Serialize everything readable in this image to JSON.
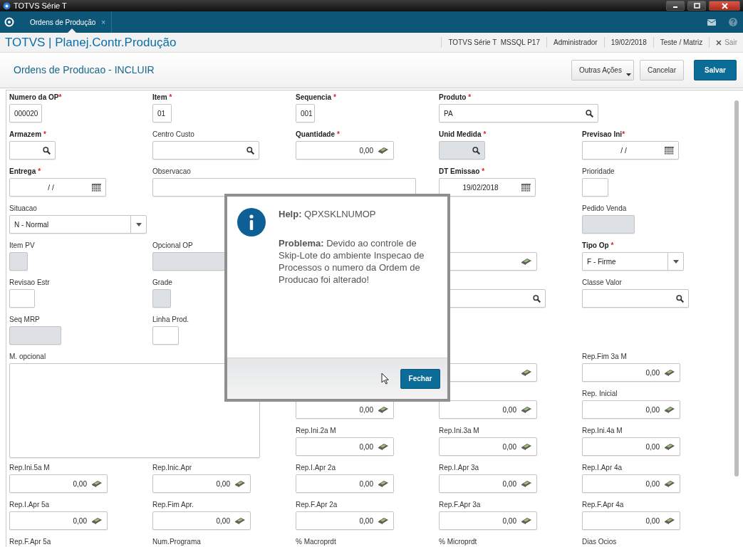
{
  "window": {
    "title": "TOTVS Série T"
  },
  "tabs": [
    {
      "label": "Ordens de Produção",
      "close": "×",
      "selected": true
    }
  ],
  "app_header": {
    "title": "TOTVS | Planej.Contr.Produção",
    "info": [
      "TOTVS Série T  MSSQL P17",
      "Administrador",
      "19/02/2018",
      "Teste / Matriz"
    ],
    "logout": "Sair"
  },
  "page": {
    "title": "Ordens de Producao - INCLUIR",
    "buttons": [
      {
        "label": "Outras Ações",
        "kind": "menu"
      },
      {
        "label": "Cancelar",
        "kind": "default"
      },
      {
        "label": "Salvar",
        "kind": "primary"
      }
    ]
  },
  "form": {
    "rows": [
      [
        {
          "kind": "text",
          "label": "Numero da OP",
          "mark": "*",
          "value": "000020",
          "disabled": false
        },
        {
          "kind": "text",
          "label": "Item",
          "mark": "*",
          "value": "01",
          "disabled": false
        },
        {
          "kind": "text",
          "label": "Sequencia",
          "mark": "*",
          "value": "001",
          "disabled": false
        },
        {
          "kind": "search",
          "label": "Produto",
          "mark": "*",
          "value": "PA",
          "disabled": false
        },
        {
          "kind": "none"
        }
      ],
      [
        {
          "kind": "search",
          "label": "Armazem",
          "mark": "*",
          "disabled": false
        },
        {
          "kind": "search",
          "label": "Centro Custo",
          "disabled": false
        },
        {
          "kind": "calc",
          "label": "Quantidade",
          "mark": "*",
          "value": "0,00",
          "disabled": false
        },
        {
          "kind": "search",
          "label": "Unid Medida",
          "mark": "*",
          "disabled": true
        },
        {
          "kind": "date",
          "label": "Previsao Ini",
          "mark": "*",
          "value": "/ /",
          "disabled": false
        }
      ],
      [
        {
          "kind": "date",
          "label": "Entrega",
          "mark": "*",
          "value": "/ /",
          "disabled": false
        },
        {
          "kind": "text",
          "label": "Observacao",
          "disabled": false
        },
        {
          "kind": "none"
        },
        {
          "kind": "date",
          "label": "DT Emissao",
          "mark": "*",
          "value": "19/02/2018",
          "disabled": false
        },
        {
          "kind": "text",
          "label": "Prioridade",
          "disabled": false
        }
      ],
      [
        {
          "kind": "select",
          "label": "Situacao",
          "value": "N - Normal",
          "disabled": false
        },
        {
          "kind": "none"
        },
        {
          "kind": "none"
        },
        {
          "kind": "none"
        },
        {
          "kind": "text",
          "label": "Pedido Venda",
          "disabled": true
        }
      ],
      [
        {
          "kind": "text",
          "label": "Item PV",
          "disabled": true
        },
        {
          "kind": "text",
          "label": "Opcional OP",
          "disabled": true
        },
        {
          "kind": "none"
        },
        {
          "kind": "calc",
          "disabled": false
        },
        {
          "kind": "select",
          "label": "Tipo Op",
          "mark": "*",
          "value": "F - Firme",
          "disabled": false
        }
      ],
      [
        {
          "kind": "text",
          "label": "Revisao Estr",
          "disabled": false
        },
        {
          "kind": "text",
          "label": "Grade",
          "disabled": true
        },
        {
          "kind": "none"
        },
        {
          "kind": "search",
          "disabled": false
        },
        {
          "kind": "search",
          "label": "Classe Valor",
          "disabled": false
        }
      ],
      [
        {
          "kind": "text",
          "label": "Seq MRP",
          "disabled": true
        },
        {
          "kind": "text",
          "label": "Linha Prod.",
          "disabled": false
        },
        {
          "kind": "none"
        },
        {
          "kind": "none"
        },
        {
          "kind": "none"
        }
      ],
      [
        {
          "kind": "memo",
          "label": "M. opcional",
          "disabled": false
        },
        {
          "kind": "none"
        },
        {
          "kind": "none"
        },
        {
          "kind": "calc",
          "disabled": false
        },
        {
          "kind": "calc",
          "label": "Rep.Fim 3a M",
          "value": "0,00",
          "disabled": false
        }
      ],
      [
        {
          "kind": "none"
        },
        {
          "kind": "none"
        },
        {
          "kind": "calc",
          "value": "0,00",
          "disabled": false
        },
        {
          "kind": "calc",
          "value": "0,00",
          "disabled": false
        },
        {
          "kind": "calc",
          "label": "Rep. Inicial",
          "value": "0,00",
          "disabled": false
        }
      ],
      [
        {
          "kind": "none"
        },
        {
          "kind": "none"
        },
        {
          "kind": "calc",
          "label": "Rep.Ini.2a M",
          "value": "0,00",
          "disabled": false
        },
        {
          "kind": "calc",
          "label": "Rep.Ini.3a M",
          "value": "0,00",
          "disabled": false
        },
        {
          "kind": "calc",
          "label": "Rep.Ini.4a M",
          "value": "0,00",
          "disabled": false
        }
      ],
      [
        {
          "kind": "calc",
          "label": "Rep.Ini.5a M",
          "value": "0,00",
          "disabled": false
        },
        {
          "kind": "calc",
          "label": "Rep.Inic.Apr",
          "value": "0,00",
          "disabled": false
        },
        {
          "kind": "calc",
          "label": "Rep.I.Apr 2a",
          "value": "0,00",
          "disabled": false
        },
        {
          "kind": "calc",
          "label": "Rep.I.Apr 3a",
          "value": "0,00",
          "disabled": false
        },
        {
          "kind": "calc",
          "label": "Rep.I.Apr 4a",
          "value": "0,00",
          "disabled": false
        }
      ],
      [
        {
          "kind": "calc",
          "label": "Rep.I.Apr 5a",
          "value": "0,00",
          "disabled": false
        },
        {
          "kind": "calc",
          "label": "Rep.Fim Apr.",
          "value": "0,00",
          "disabled": false
        },
        {
          "kind": "calc",
          "label": "Rep.F.Apr 2a",
          "value": "0,00",
          "disabled": false
        },
        {
          "kind": "calc",
          "label": "Rep.F.Apr 3a",
          "value": "0,00",
          "disabled": false
        },
        {
          "kind": "calc",
          "label": "Rep.F.Apr 4a",
          "value": "0,00",
          "disabled": false
        }
      ],
      [
        {
          "kind": "label",
          "label": "Rep.F.Apr 5a"
        },
        {
          "kind": "label",
          "label": "Num.Programa"
        },
        {
          "kind": "label",
          "label": "% Macroprdt"
        },
        {
          "kind": "label",
          "label": "% Microprdt"
        },
        {
          "kind": "label",
          "label": "Dias Ocios"
        }
      ]
    ]
  },
  "dialog": {
    "heading": "**Help:** QPXSKLNUMOP",
    "message": "**Problema:** Devido ao controle de Skip-Lote do ambiente Inspecao de Processos o numero da Ordem de Producao foi alterado!",
    "button": "Fechar"
  }
}
